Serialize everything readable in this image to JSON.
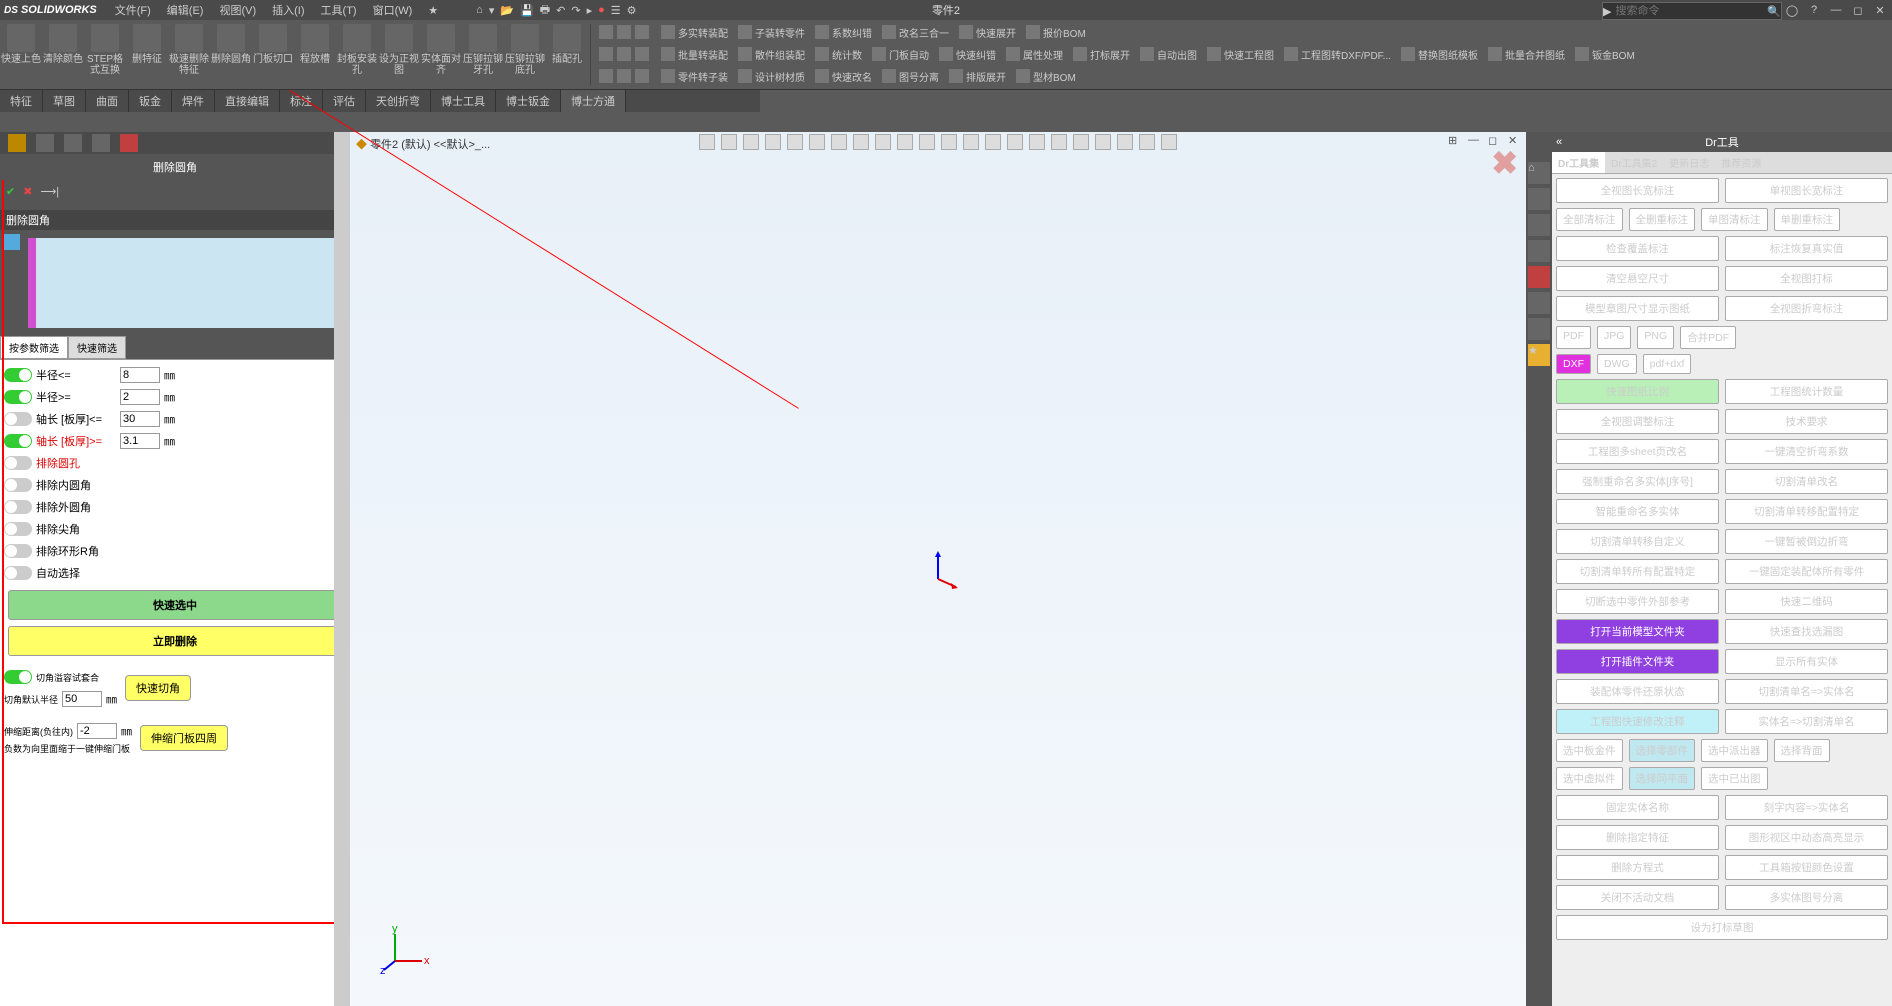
{
  "app": {
    "name": "SOLIDWORKS",
    "doc": "零件2"
  },
  "menu": [
    "文件(F)",
    "编辑(E)",
    "视图(V)",
    "插入(I)",
    "工具(T)",
    "窗口(W)"
  ],
  "search": {
    "placeholder": "搜索命令"
  },
  "ribbon1": [
    "快速上色",
    "清除颜色",
    "STEP格式互换",
    "删特征",
    "极速删除特征",
    "删除圆角",
    "门板切口",
    "程放槽",
    "封板安装孔",
    "设为正视图",
    "实体面对齐",
    "压铆拉铆牙孔",
    "压铆拉铆底孔",
    "插配孔"
  ],
  "ribbonG": [
    [
      "多实转装配",
      "子装转零件",
      "",
      "系数纠错",
      "改名三合一",
      "",
      "快速展开",
      "",
      "",
      "报价BOM"
    ],
    [
      "批量转装配",
      "散件组装配",
      "统计数",
      "门板自动",
      "快速纠错",
      "属性处理",
      "",
      "打标展开",
      "自动出图",
      "快速工程图",
      "工程图转DXF/PDF...",
      "替换图纸模板",
      "批量合并图纸",
      "钣金BOM"
    ],
    [
      "零件转子装",
      "设计树材质",
      "",
      "快速改名",
      "图号分离",
      "",
      "排版展开",
      "",
      "",
      "型材BOM"
    ]
  ],
  "tabs": [
    "特征",
    "草图",
    "曲面",
    "钣金",
    "焊件",
    "直接编辑",
    "标注",
    "评估",
    "天创折弯",
    "博士工具",
    "博士钣金",
    "博士方通"
  ],
  "pm": {
    "title": "删除圆角",
    "sect": "删除圆角",
    "ftabs": [
      "按参数筛选",
      "快速筛选"
    ],
    "filters": [
      {
        "lbl": "半径<=",
        "val": "8",
        "on": true
      },
      {
        "lbl": "半径>=",
        "val": "2",
        "on": true
      },
      {
        "lbl": "轴长 [板厚]<=",
        "val": "30",
        "on": false
      },
      {
        "lbl": "轴长 [板厚]>=",
        "val": "3.1",
        "on": true,
        "red": true
      }
    ],
    "exclLabel": "排除圆孔",
    "checks": [
      "排除内圆角",
      "排除外圆角",
      "排除尖角",
      "排除环形R角",
      "自动选择"
    ],
    "btns": {
      "quick": "快速选中",
      "del": "立即删除",
      "fil": "快速切角",
      "shrink": "伸缩门板四周"
    },
    "extra1": "切角溢容试套合",
    "extra1v": "50",
    "extra2": "伸缩距离(负往内)",
    "extra2v": "-2",
    "note": "负数为向里面缩于一键伸缩门板"
  },
  "crumb": "零件2 (默认) <<默认>_...",
  "rp": {
    "title": "Dr工具",
    "tabs": [
      "Dr工具集",
      "Dr工具集2",
      "更新日志",
      "推荐资源"
    ],
    "rows": [
      [
        {
          "t": "全视图长宽标注"
        },
        {
          "t": "单视图长宽标注"
        }
      ],
      [
        {
          "t": "全部清标注",
          "sm": 1
        },
        {
          "t": "全删重标注",
          "sm": 1
        },
        {
          "t": "单图清标注",
          "sm": 1
        },
        {
          "t": "单删重标注",
          "sm": 1
        }
      ],
      [
        {
          "t": "检查覆盖标注"
        },
        {
          "t": "标注恢复真实值"
        }
      ],
      [
        {
          "t": "清空悬空尺寸"
        },
        {
          "t": "全视图打标"
        }
      ],
      [
        {
          "t": "模型章图尺寸显示图纸"
        },
        {
          "t": "全视图折弯标注"
        }
      ],
      [
        {
          "t": "PDF",
          "sm": 1
        },
        {
          "t": "JPG",
          "sm": 1
        },
        {
          "t": "PNG",
          "sm": 1
        },
        {
          "t": "合并PDF",
          "sm": 1
        }
      ],
      [
        {
          "t": "DXF",
          "c": "magenta",
          "sm": 1
        },
        {
          "t": "DWG",
          "sm": 1
        },
        {
          "t": "pdf+dxf",
          "sm": 1
        }
      ],
      [
        {
          "t": "快速图纸比例",
          "c": "lg"
        },
        {
          "t": "工程图统计数量"
        }
      ],
      [
        {
          "t": "全视图调整标注"
        },
        {
          "t": "技术要求"
        }
      ],
      [
        {
          "t": "工程图多sheet页改名"
        },
        {
          "t": "一键清空折弯系数"
        }
      ],
      [
        {
          "t": "强制重命名多实体[序号]"
        },
        {
          "t": "切割清单改名"
        }
      ],
      [
        {
          "t": "智能重命名多实体"
        },
        {
          "t": "切割清单转移配置特定"
        }
      ],
      [
        {
          "t": "切割清单转移自定义"
        },
        {
          "t": "一键暂被倒边折弯"
        }
      ],
      [
        {
          "t": "切割清单转所有配置特定"
        },
        {
          "t": "一键固定装配体所有零件"
        }
      ],
      [
        {
          "t": "切断选中零件外部参考"
        },
        {
          "t": "快速二维码"
        }
      ],
      [
        {
          "t": "打开当前模型文件夹",
          "c": "pur"
        },
        {
          "t": "快速查找选漏图"
        }
      ],
      [
        {
          "t": "打开插件文件夹",
          "c": "pur"
        },
        {
          "t": "显示所有实体"
        }
      ],
      [
        {
          "t": "装配体零件还原状态"
        },
        {
          "t": "切割清单名=>实体名"
        }
      ],
      [
        {
          "t": "工程图快速修改注释",
          "c": "cy"
        },
        {
          "t": "实体名=>切割清单名"
        }
      ],
      [
        {
          "t": "选中板金件",
          "sm": 1
        },
        {
          "t": "选择零部件",
          "c": "cy2",
          "sm": 1
        },
        {
          "t": "选中派出器",
          "sm": 1
        },
        {
          "t": "选择背面",
          "sm": 1
        }
      ],
      [
        {
          "t": "选中虚拟件",
          "sm": 1
        },
        {
          "t": "选择同平面",
          "c": "cy2",
          "sm": 1
        },
        {
          "t": "选中已出图",
          "sm": 1
        }
      ],
      [
        {
          "t": "固定实体名称"
        },
        {
          "t": "刻字内容=>实体名"
        }
      ],
      [
        {
          "t": "删除指定特征"
        },
        {
          "t": "图形视区中动态高亮显示"
        }
      ],
      [
        {
          "t": "删除方程式"
        },
        {
          "t": "工具箱按钮颜色设置"
        }
      ],
      [
        {
          "t": "关闭不活动文档"
        },
        {
          "t": "多实体图号分离"
        }
      ],
      [
        {
          "t": "设为打标草图"
        }
      ]
    ]
  }
}
